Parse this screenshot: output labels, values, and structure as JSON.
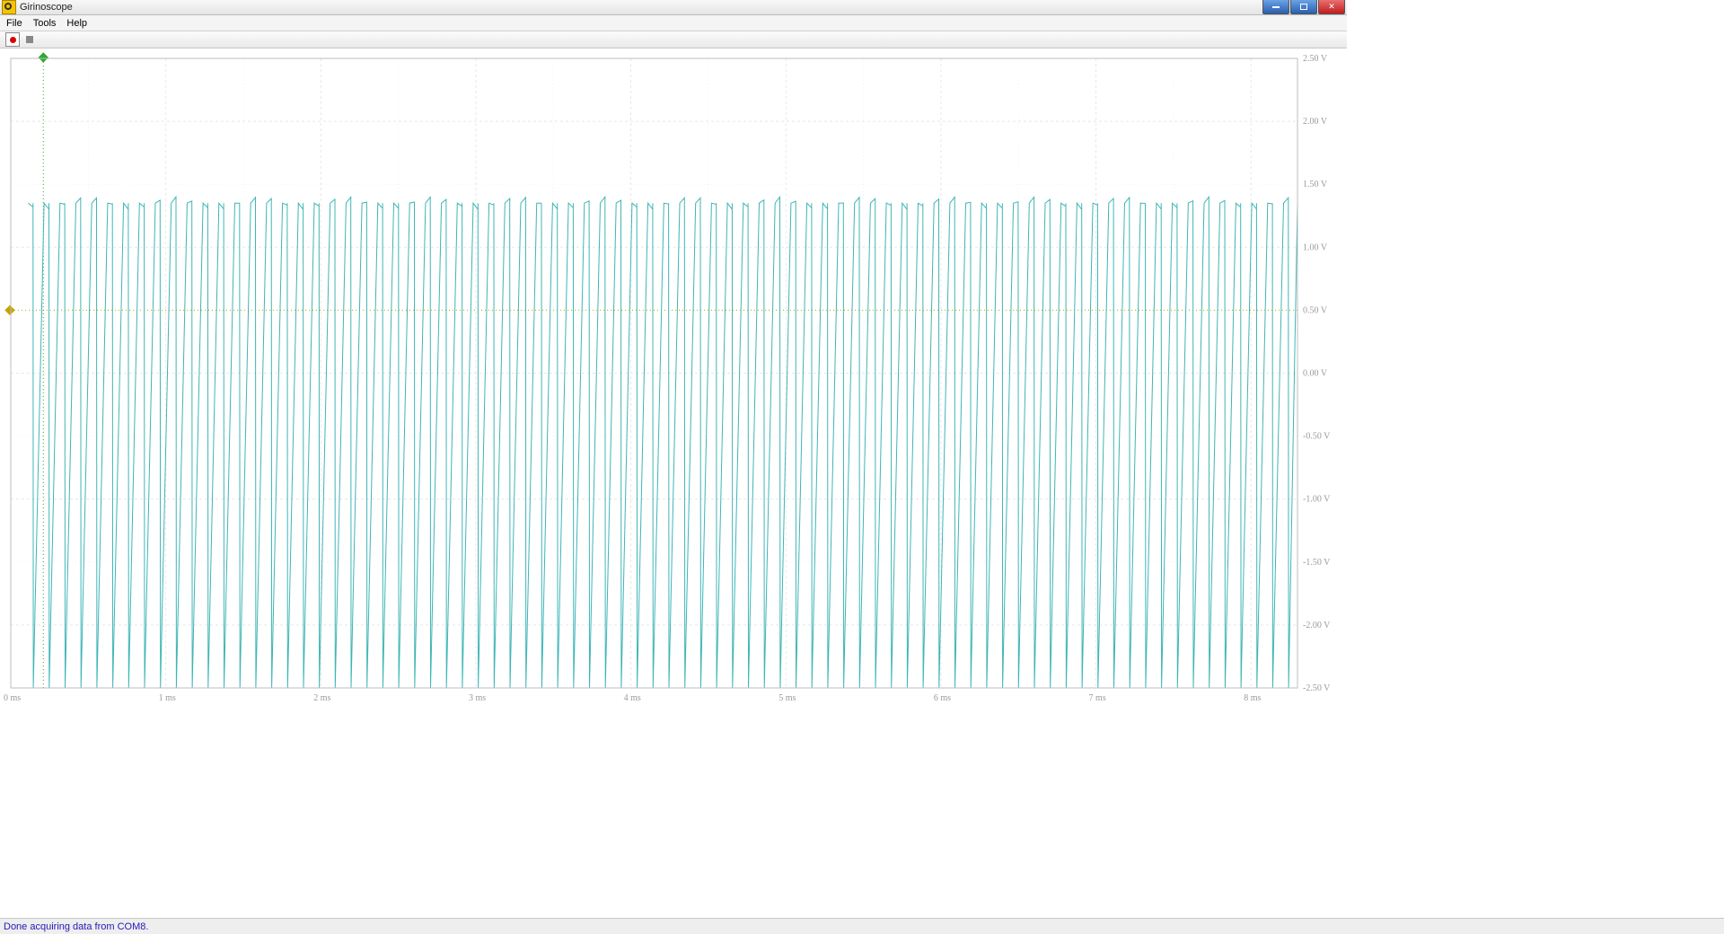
{
  "window": {
    "title": "Girinoscope"
  },
  "menu": {
    "file": "File",
    "tools": "Tools",
    "help": "Help"
  },
  "status": {
    "text": "Done acquiring data from COM8."
  },
  "chart_data": {
    "type": "line",
    "title": "",
    "x_unit": "ms",
    "y_unit": "V",
    "xlim": [
      0,
      8.3
    ],
    "ylim": [
      -2.5,
      2.5
    ],
    "x_ticks": [
      0,
      1,
      2,
      3,
      4,
      5,
      6,
      7,
      8
    ],
    "x_tick_labels": [
      "0 ms",
      "1 ms",
      "2 ms",
      "3 ms",
      "4 ms",
      "5 ms",
      "6 ms",
      "7 ms",
      "8 ms"
    ],
    "y_ticks": [
      2.5,
      2.0,
      1.5,
      1.0,
      0.5,
      0.0,
      -0.5,
      -1.0,
      -1.5,
      -2.0,
      -2.5
    ],
    "y_tick_labels": [
      "2.50 V",
      "2.00 V",
      "1.50 V",
      "1.00 V",
      "0.50 V",
      "0.00 V",
      "-0.50 V",
      "-1.00 V",
      "-1.50 V",
      "-2.00 V",
      "-2.50 V"
    ],
    "trigger_time_ms": 0.21,
    "trigger_level_v": 0.5,
    "waveform": {
      "description": "Periodic sawtooth/ramp-like pulse train. Each cycle: segment at ~1.35 V for a short plateau, then rapid fall to ~-2.50 V, then ramp back up. ~81 cycles across 0–8.3 ms.",
      "frequency_hz_approx": 9760,
      "period_ms_approx": 0.1025,
      "high_v": 1.35,
      "low_v": -2.5,
      "cycles_visible": 81,
      "series_color": "#3fb5b5"
    }
  },
  "colors": {
    "grid_major": "#e8e8e8",
    "grid_minor": "#f3f3f3",
    "trigger_time": "#2fa82f",
    "trigger_level": "#c4a400",
    "axis_text": "#9a9a9a"
  }
}
